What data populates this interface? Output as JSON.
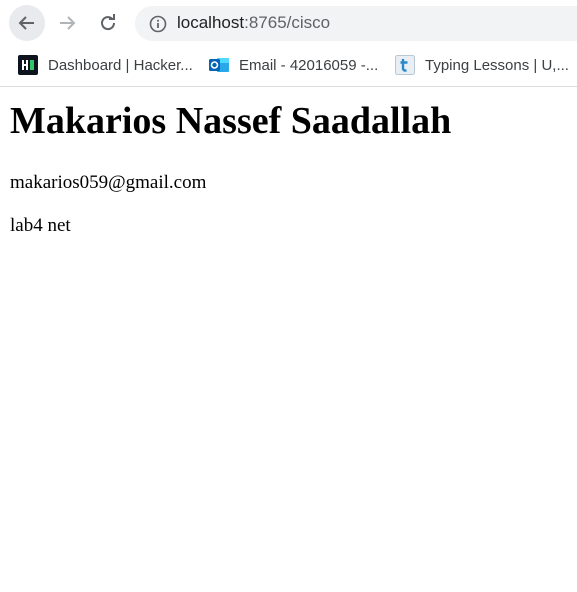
{
  "browser": {
    "url_host": "localhost",
    "url_rest": ":8765/cisco",
    "bookmarks": [
      {
        "label": "Dashboard | Hacker...",
        "icon": "hackerrank-icon"
      },
      {
        "label": "Email - 42016059 -...",
        "icon": "outlook-icon"
      },
      {
        "label": "Typing Lessons | U,...",
        "icon": "typing-icon"
      }
    ]
  },
  "page": {
    "heading": "Makarios Nassef Saadallah",
    "email": "makarios059@gmail.com",
    "note": "lab4 net"
  }
}
